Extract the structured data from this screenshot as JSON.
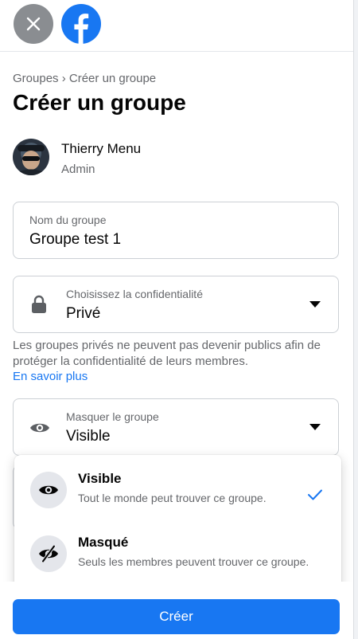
{
  "header": {
    "close_icon": "close-icon",
    "logo_icon": "facebook-logo-icon"
  },
  "breadcrumb": {
    "parent": "Groupes",
    "separator": "›",
    "current": "Créer un groupe"
  },
  "page_title": "Créer un groupe",
  "admin": {
    "name": "Thierry Menu",
    "role": "Admin"
  },
  "group_name_field": {
    "label": "Nom du groupe",
    "value": "Groupe test 1"
  },
  "privacy_field": {
    "label": "Choisissez la confidentialité",
    "value": "Privé",
    "icon": "lock-icon"
  },
  "privacy_help": {
    "text": "Les groupes privés ne peuvent pas devenir publics afin de protéger la confidentialité de leurs membres.",
    "link": "En savoir plus"
  },
  "visibility_field": {
    "label": "Masquer le groupe",
    "value": "Visible",
    "icon": "eye-icon"
  },
  "visibility_options": [
    {
      "title": "Visible",
      "description": "Tout le monde peut trouver ce groupe.",
      "icon": "eye-icon",
      "selected": true
    },
    {
      "title": "Masqué",
      "description": "Seuls les membres peuvent trouver ce groupe.",
      "icon": "eye-slash-icon",
      "selected": false
    }
  ],
  "create_button": "Créer",
  "colors": {
    "accent": "#1877f2",
    "text_primary": "#050505",
    "text_secondary": "#65676b",
    "border": "#ccd0d5"
  }
}
